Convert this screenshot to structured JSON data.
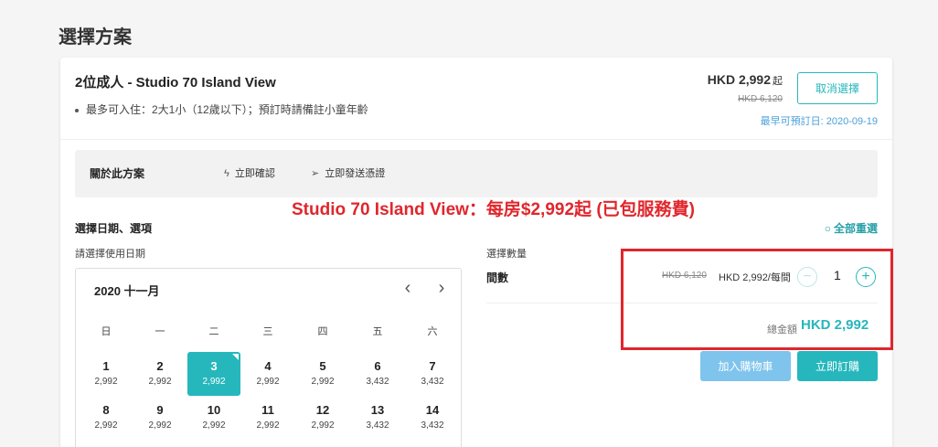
{
  "page": {
    "title": "選擇方案"
  },
  "plan": {
    "name": "2位成人 - Studio 70 Island View",
    "note": "最多可入住：2大1小（12歲以下）；預訂時請備註小童年齡",
    "price": "HKD 2,992",
    "price_suffix": "起",
    "original_price": "HKD 6,120",
    "cancel_label": "取消選擇",
    "earliest_date": "最早可預訂日: 2020-09-19"
  },
  "about": {
    "label": "關於此方案",
    "items": [
      {
        "icon": "lightning-icon",
        "text": "立即確認"
      },
      {
        "icon": "send-icon",
        "text": "立即發送憑證"
      }
    ]
  },
  "promo": "Studio 70 Island View：每房$2,992起 (已包服務費)",
  "selection": {
    "title": "選擇日期、選項",
    "reset_label": "全部重選",
    "date_label": "請選擇使用日期"
  },
  "calendar": {
    "month": "2020 十一月",
    "weekdays": [
      "日",
      "一",
      "二",
      "三",
      "四",
      "五",
      "六"
    ],
    "weeks": [
      [
        {
          "day": "1",
          "price": "2,992"
        },
        {
          "day": "2",
          "price": "2,992"
        },
        {
          "day": "3",
          "price": "2,992",
          "selected": true
        },
        {
          "day": "4",
          "price": "2,992"
        },
        {
          "day": "5",
          "price": "2,992"
        },
        {
          "day": "6",
          "price": "3,432"
        },
        {
          "day": "7",
          "price": "3,432"
        }
      ],
      [
        {
          "day": "8",
          "price": "2,992"
        },
        {
          "day": "9",
          "price": "2,992"
        },
        {
          "day": "10",
          "price": "2,992"
        },
        {
          "day": "11",
          "price": "2,992"
        },
        {
          "day": "12",
          "price": "2,992"
        },
        {
          "day": "13",
          "price": "3,432"
        },
        {
          "day": "14",
          "price": "3,432"
        }
      ]
    ]
  },
  "quantity": {
    "label": "選擇數量",
    "item_label": "間數",
    "original_price": "HKD 6,120",
    "unit_price": "HKD 2,992/每間",
    "value": "1",
    "total_label": "總金額",
    "total_value": "HKD 2,992"
  },
  "actions": {
    "add_to_cart": "加入購物車",
    "book_now": "立即訂購"
  },
  "colors": {
    "accent": "#26b7bc",
    "promo": "#e0262c",
    "cart_button": "#7fc4ec"
  }
}
